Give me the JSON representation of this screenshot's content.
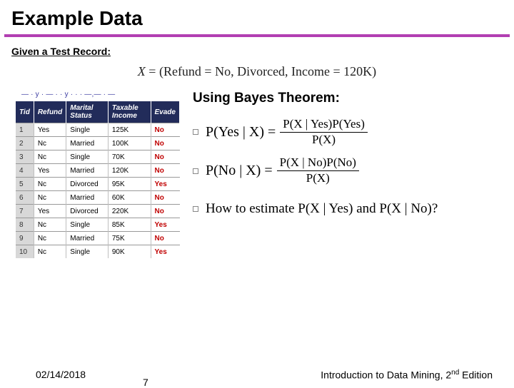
{
  "title": "Example Data",
  "subtitle": "Given a Test Record:",
  "test_record": "X = (Refund = No, Divorced, Income = 120K)",
  "garble_caption": "— · y · — · · y · · · —,— · —",
  "table": {
    "headers": [
      "Tid",
      "Refund",
      "Marital Status",
      "Taxable Income",
      "Evade"
    ],
    "rows": [
      {
        "tid": "1",
        "refund": "Yes",
        "status": "Single",
        "income": "125K",
        "evade": "No"
      },
      {
        "tid": "2",
        "refund": "Nc",
        "status": "Married",
        "income": "100K",
        "evade": "No"
      },
      {
        "tid": "3",
        "refund": "Nc",
        "status": "Single",
        "income": "70K",
        "evade": "No"
      },
      {
        "tid": "4",
        "refund": "Yes",
        "status": "Married",
        "income": "120K",
        "evade": "No"
      },
      {
        "tid": "5",
        "refund": "Nc",
        "status": "Divorced",
        "income": "95K",
        "evade": "Yes"
      },
      {
        "tid": "6",
        "refund": "Nc",
        "status": "Married",
        "income": "60K",
        "evade": "No"
      },
      {
        "tid": "7",
        "refund": "Yes",
        "status": "Divorced",
        "income": "220K",
        "evade": "No"
      },
      {
        "tid": "8",
        "refund": "Nc",
        "status": "Single",
        "income": "85K",
        "evade": "Yes"
      },
      {
        "tid": "9",
        "refund": "Nc",
        "status": "Married",
        "income": "75K",
        "evade": "No"
      },
      {
        "tid": "10",
        "refund": "Nc",
        "status": "Single",
        "income": "90K",
        "evade": "Yes"
      }
    ]
  },
  "bayes": {
    "heading": "Using Bayes Theorem:",
    "eq1_lhs": "P(Yes | X) = ",
    "eq1_num": "P(X | Yes)P(Yes)",
    "eq1_den": "P(X)",
    "eq2_lhs": "P(No | X) = ",
    "eq2_num": "P(X | No)P(No)",
    "eq2_den": "P(X)",
    "howto": "How to estimate P(X | Yes) and P(X | No)?"
  },
  "footer": {
    "date": "02/14/2018",
    "book_pre": "Introduction to Data Mining, 2",
    "book_sup": "nd",
    "book_post": " Edition",
    "page": "7"
  }
}
